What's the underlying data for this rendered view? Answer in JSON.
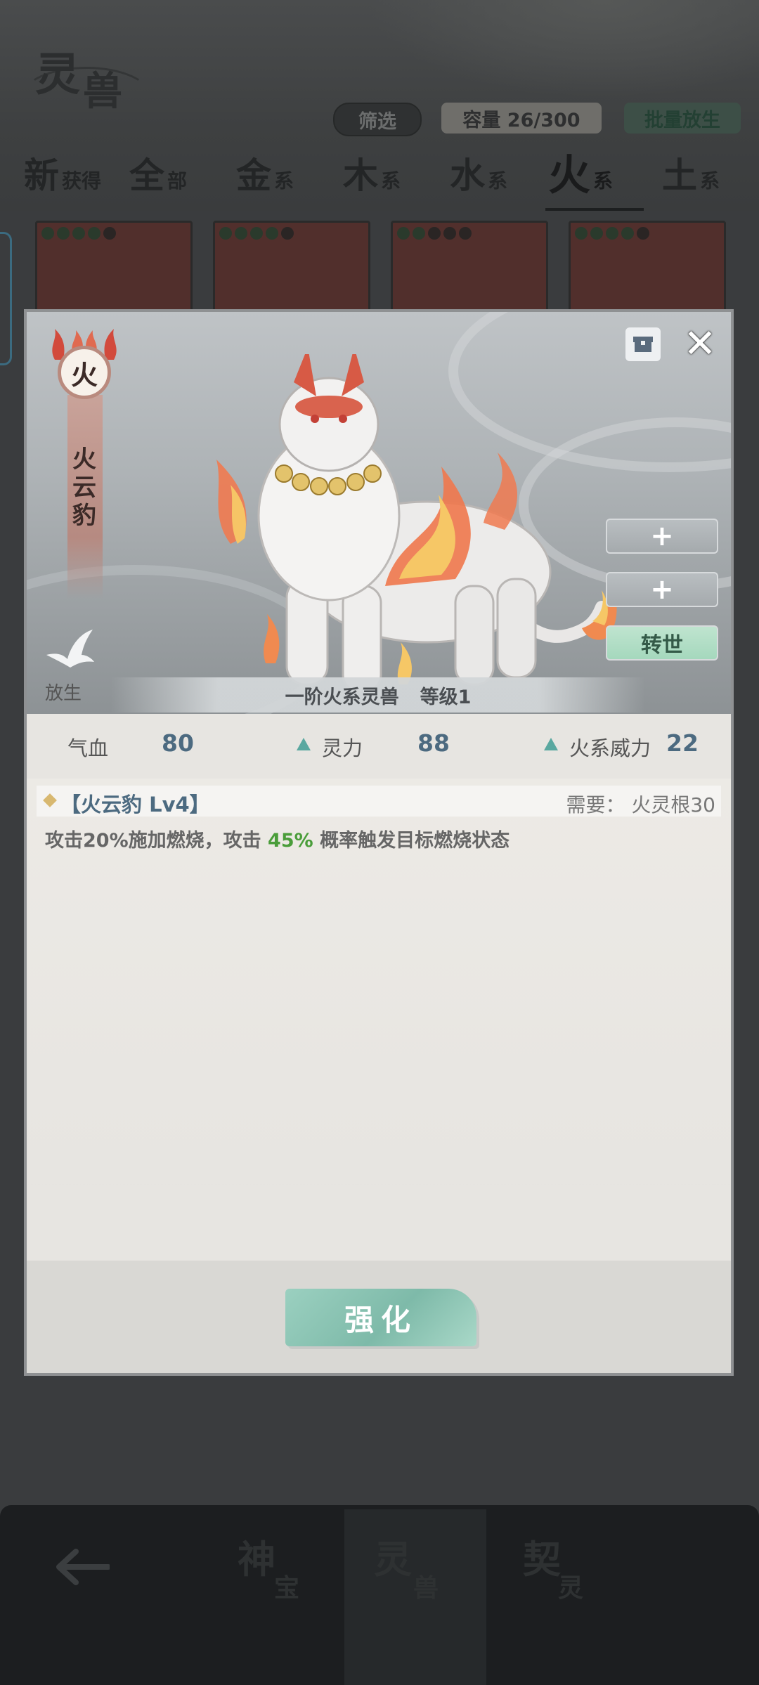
{
  "header": {
    "logo_text": [
      "灵",
      "兽"
    ],
    "filter_label": "筛选",
    "capacity_label": "容量 26/300",
    "batch_release_label": "批量放生"
  },
  "tabs": [
    {
      "big": "新",
      "small": "获得"
    },
    {
      "big": "全",
      "small": "部"
    },
    {
      "big": "金",
      "small": "系"
    },
    {
      "big": "木",
      "small": "系"
    },
    {
      "big": "水",
      "small": "系"
    },
    {
      "big": "火",
      "small": "系",
      "active": true
    },
    {
      "big": "土",
      "small": "系"
    }
  ],
  "bottom_nav": [
    {
      "a": "神",
      "b": "宝"
    },
    {
      "a": "灵",
      "b": "兽",
      "active": true
    },
    {
      "a": "契",
      "b": "灵"
    }
  ],
  "modal": {
    "element_char": "火",
    "beast_name": "火云豹",
    "release_label": "放生",
    "plus_button_1": "+",
    "plus_button_2": "+",
    "rebirth_label": "转世",
    "rank_text": "一阶火系灵兽",
    "level_text": "等级1",
    "stats": {
      "hp_label": "气血",
      "hp_value": "80",
      "spirit_label": "灵力",
      "spirit_value": "88",
      "fire_power_label": "火系威力",
      "fire_power_value": "22"
    },
    "skill": {
      "name": "【火云豹 Lv4】",
      "requirement": "需要： 火灵根30",
      "desc_part1": "攻击20%施加燃烧，攻击 ",
      "desc_highlight": "45%",
      "desc_part2": " 概率触发目标燃烧状态"
    },
    "enhance_label": "强化"
  },
  "colors": {
    "accent_green": "#7ebaa9",
    "value_blue": "#4c6a80",
    "highlight_green": "#4a9d3a",
    "fire_red": "#b98a7e"
  }
}
